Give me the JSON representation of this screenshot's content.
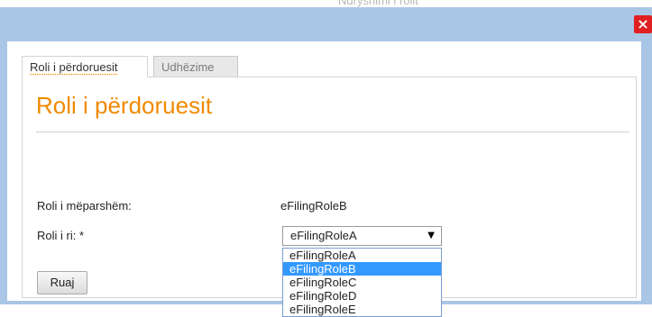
{
  "backdrop": {
    "text": "Ndryshimi i rolit"
  },
  "dialog": {
    "close_glyph": "×"
  },
  "tabs": [
    {
      "label": "Roli i përdoruesit",
      "active": true
    },
    {
      "label": "Udhëzime",
      "active": false
    }
  ],
  "page": {
    "title": "Roli i përdoruesit"
  },
  "form": {
    "previous_role_label": "Roli i mëparshëm:",
    "previous_role_value": "eFilingRoleB",
    "new_role_label": "Roli i ri: *",
    "new_role_selected": "eFilingRoleA",
    "dropdown_arrow": "▼",
    "options": [
      "eFilingRoleA",
      "eFilingRoleB",
      "eFilingRoleC",
      "eFilingRoleD",
      "eFilingRoleE"
    ],
    "highlighted_option": "eFilingRoleB",
    "save_label": "Ruaj"
  },
  "colors": {
    "accent": "#f08a00",
    "frame": "#a9c6e6",
    "highlight": "#3399ff",
    "close": "#e02020"
  }
}
